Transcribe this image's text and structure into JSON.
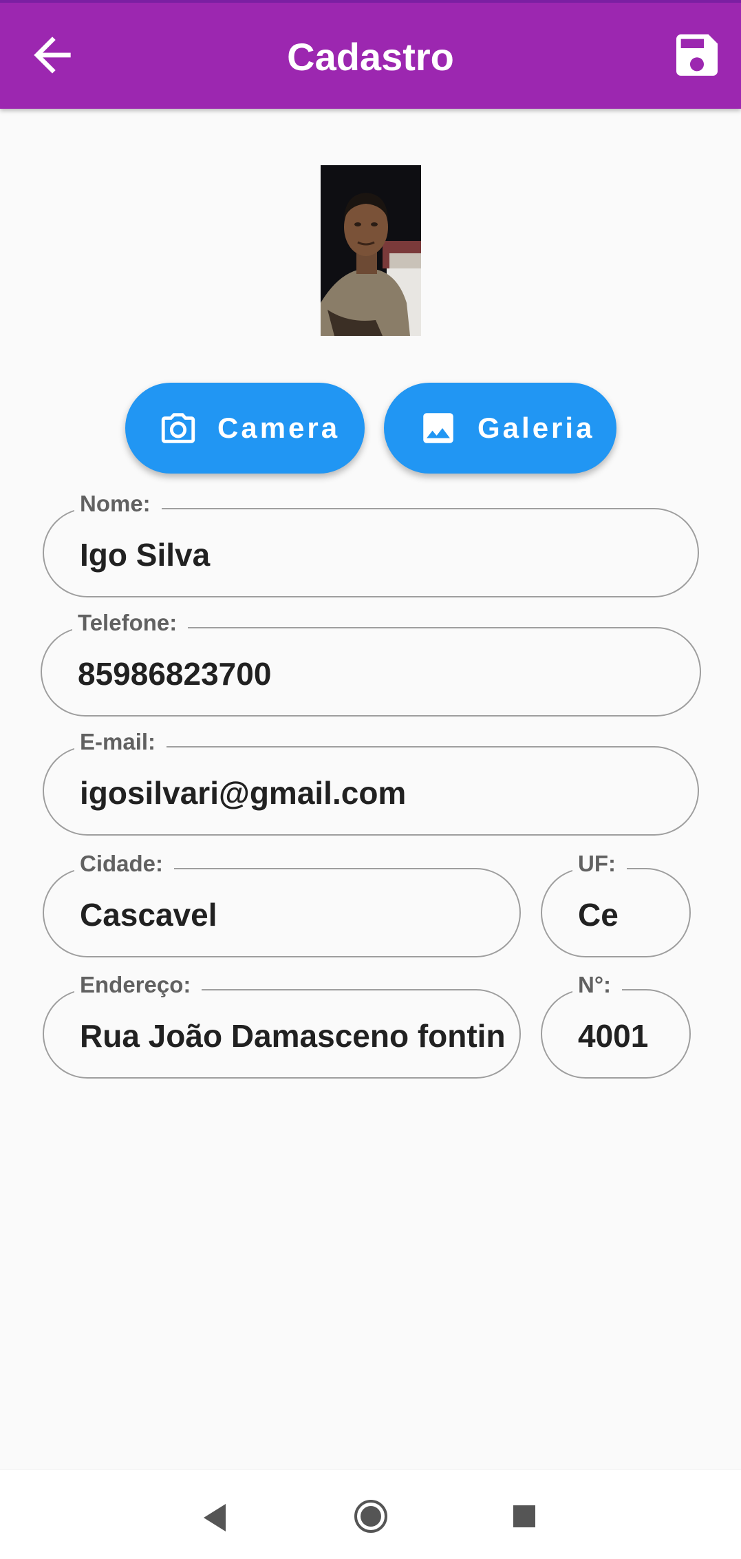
{
  "app_bar": {
    "title": "Cadastro",
    "back_icon": "arrow-back-icon",
    "save_icon": "save-icon",
    "color": "#9c27b0"
  },
  "photo": {
    "description_icon": "profile-photo"
  },
  "buttons": {
    "camera_label": "Camera",
    "galeria_label": "Galeria",
    "color": "#2196f3"
  },
  "form": {
    "nome": {
      "label": "Nome:",
      "value": "Igo Silva"
    },
    "telefone": {
      "label": "Telefone:",
      "value": "85986823700"
    },
    "email": {
      "label": "E-mail:",
      "value": "igosilvari@gmail.com"
    },
    "cidade": {
      "label": "Cidade:",
      "value": "Cascavel"
    },
    "uf": {
      "label": "UF:",
      "value": "Ce"
    },
    "endereco": {
      "label": "Endereço:",
      "value": "Rua João Damasceno fontin"
    },
    "numero": {
      "label": "N°:",
      "value": "4001"
    }
  },
  "system_nav": {
    "back_icon": "nav-back-icon",
    "home_icon": "nav-home-icon",
    "recents_icon": "nav-recents-icon"
  }
}
